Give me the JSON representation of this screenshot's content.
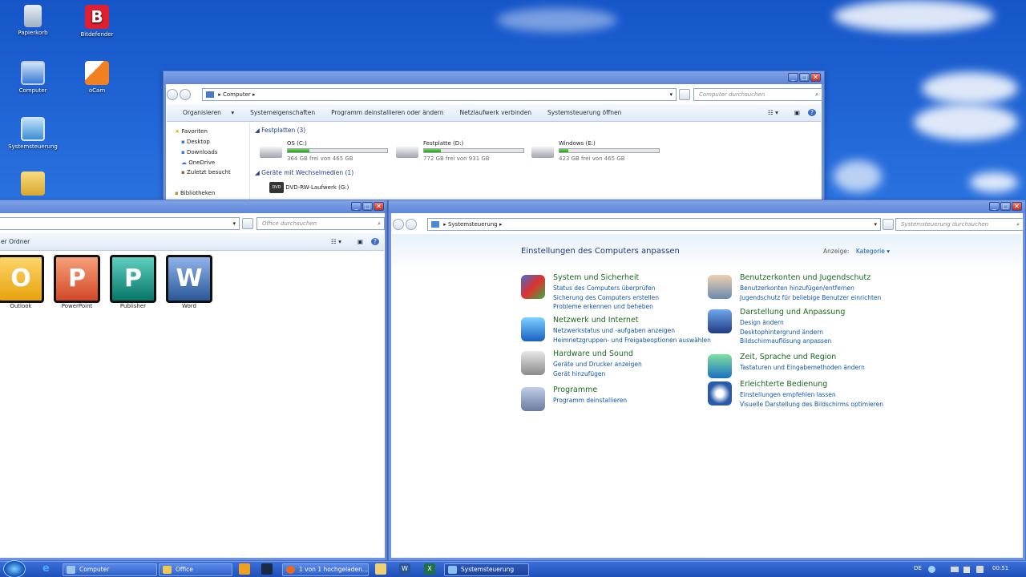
{
  "desktop": {
    "icons": [
      {
        "label": "Papierkorb",
        "icon": "recycle-bin-icon"
      },
      {
        "label": "Bitdefender",
        "icon": "bitdefender-icon"
      },
      {
        "label": "Computer",
        "icon": "computer-icon"
      },
      {
        "label": "oCam",
        "icon": "ocam-icon"
      },
      {
        "label": "Systemsteuerung",
        "icon": "control-panel-icon"
      }
    ]
  },
  "computer_window": {
    "address": "Computer",
    "search_placeholder": "Computer durchsuchen",
    "toolbar": [
      "Organisieren",
      "Systemeigenschaften",
      "Programm deinstallieren oder ändern",
      "Netzlaufwerk verbinden",
      "Systemsteuerung öffnen"
    ],
    "nav": {
      "favorites_label": "Favoriten",
      "items": [
        "Desktop",
        "Downloads",
        "OneDrive",
        "Zuletzt besucht"
      ],
      "libraries_label": "Bibliotheken"
    },
    "drives_group": "Festplatten (3)",
    "drives": [
      {
        "name": "OS (C:)",
        "free": "364 GB frei von 465 GB",
        "used_fraction": 0.22
      },
      {
        "name": "Festplatte (D:)",
        "free": "772 GB frei von 931 GB",
        "used_fraction": 0.17
      },
      {
        "name": "Windows (E:)",
        "free": "423 GB frei von 465 GB",
        "used_fraction": 0.09
      }
    ],
    "removable_group": "Geräte mit Wechselmedien (1)",
    "removable": [
      {
        "name": "DVD-RW-Laufwerk (G:)",
        "badge": "DVD"
      }
    ]
  },
  "office_window": {
    "search_placeholder": "Office durchsuchen",
    "toolbar_partial": "er Ordner",
    "apps": [
      {
        "label": "Outlook",
        "color": "#e8a20c",
        "letter": "O"
      },
      {
        "label": "PowerPoint",
        "color": "#d24726",
        "letter": "P"
      },
      {
        "label": "Publisher",
        "color": "#077568",
        "letter": "P"
      },
      {
        "label": "Word",
        "color": "#2b5797",
        "letter": "W"
      }
    ]
  },
  "control_panel": {
    "address": "Systemsteuerung",
    "search_placeholder": "Systemsteuerung durchsuchen",
    "heading": "Einstellungen des Computers anpassen",
    "view_label": "Anzeige:",
    "view_value": "Kategorie",
    "left": [
      {
        "title": "System und Sicherheit",
        "icon": "shield-icon",
        "links": [
          "Status des Computers überprüfen",
          "Sicherung des Computers erstellen",
          "Probleme erkennen und beheben"
        ]
      },
      {
        "title": "Netzwerk und Internet",
        "icon": "network-icon",
        "links": [
          "Netzwerkstatus und -aufgaben anzeigen",
          "Heimnetzgruppen- und Freigabeoptionen auswählen"
        ]
      },
      {
        "title": "Hardware und Sound",
        "icon": "printer-icon",
        "links": [
          "Geräte und Drucker anzeigen",
          "Gerät hinzufügen"
        ]
      },
      {
        "title": "Programme",
        "icon": "programs-icon",
        "links": [
          "Programm deinstallieren"
        ]
      }
    ],
    "right": [
      {
        "title": "Benutzerkonten und Jugendschutz",
        "icon": "users-icon",
        "links": [
          "Benutzerkonten hinzufügen/entfernen",
          "Jugendschutz für beliebige Benutzer einrichten"
        ]
      },
      {
        "title": "Darstellung und Anpassung",
        "icon": "display-icon",
        "links": [
          "Design ändern",
          "Desktophintergrund ändern",
          "Bildschirmauflösung anpassen"
        ]
      },
      {
        "title": "Zeit, Sprache und Region",
        "icon": "globe-clock-icon",
        "links": [
          "Tastaturen und Eingabemethoden ändern"
        ]
      },
      {
        "title": "Erleichterte Bedienung",
        "icon": "accessibility-icon",
        "links": [
          "Einstellungen empfehlen lassen",
          "Visuelle Darstellung des Bildschirms optimieren"
        ]
      }
    ]
  },
  "taskbar": {
    "items": [
      "Computer",
      "Office",
      "1 von 1 hochgeladen...",
      "Systemsteuerung"
    ],
    "language": "DE",
    "time": "00:51"
  }
}
